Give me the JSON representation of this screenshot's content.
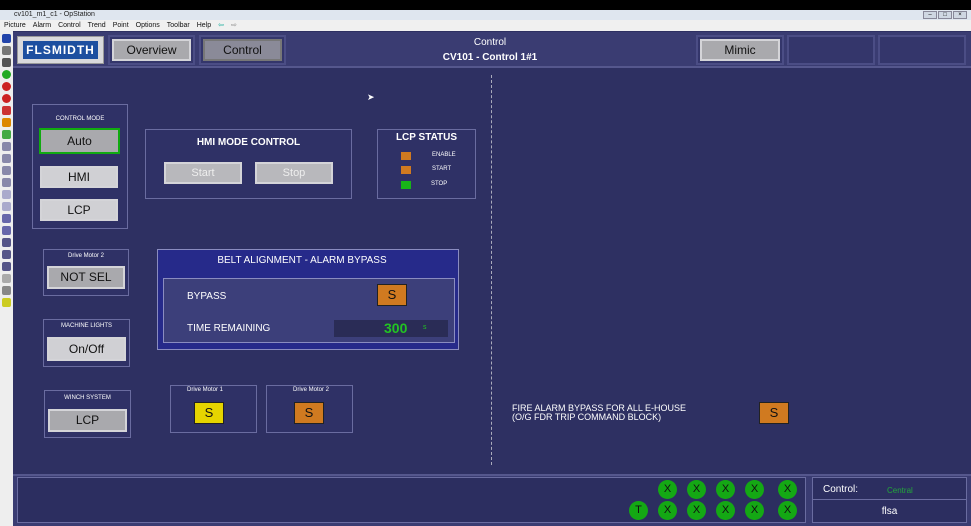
{
  "window": {
    "title": "cv101_m1_c1 - OpStation",
    "controls": [
      "–",
      "□",
      "×"
    ]
  },
  "menu": [
    "Picture",
    "Alarm",
    "Control",
    "Trend",
    "Point",
    "Options",
    "Toolbar",
    "Help"
  ],
  "header": {
    "logo": "FLSMIDTH",
    "overview": "Overview",
    "control": "Control",
    "title": "Control",
    "subtitle": "CV101 - Control 1#1",
    "mimic": "Mimic"
  },
  "control_mode": {
    "label": "CONTROL MODE",
    "auto": "Auto",
    "hmi": "HMI",
    "lcp": "LCP"
  },
  "hmi_mode": {
    "title": "HMI MODE CONTROL",
    "start": "Start",
    "stop": "Stop"
  },
  "lcp_status": {
    "title": "LCP STATUS",
    "items": [
      {
        "label": "ENABLE",
        "color": "#d07a20"
      },
      {
        "label": "START",
        "color": "#d07a20"
      },
      {
        "label": "STOP",
        "color": "#18b418"
      }
    ]
  },
  "drive_motor_2_sel": {
    "label": "Drive Motor 2",
    "value": "NOT SEL"
  },
  "machine_lights": {
    "label": "MACHINE LIGHTS",
    "value": "On/Off"
  },
  "winch": {
    "label": "WINCH SYSTEM",
    "value": "LCP"
  },
  "belt": {
    "title": "BELT ALIGNMENT - ALARM BYPASS",
    "bypass_label": "BYPASS",
    "bypass_state": "S",
    "time_label": "TIME REMAINING",
    "time_value": "300",
    "time_unit": "s"
  },
  "motors": [
    {
      "label": "Drive Motor 1",
      "state": "S",
      "color": "#e6d400"
    },
    {
      "label": "Drive Motor 2",
      "state": "S",
      "color": "#d07a20"
    }
  ],
  "fire": {
    "line1": "FIRE ALARM BYPASS FOR ALL E-HOUSE",
    "line2": "(O/G FDR TRIP COMMAND BLOCK)",
    "state": "S"
  },
  "footer": {
    "row1": [
      "X",
      "X",
      "X",
      "X",
      "X"
    ],
    "row2": [
      "T",
      "X",
      "X",
      "X",
      "X",
      "X"
    ],
    "control_label": "Control:",
    "control_value": "Central",
    "user": "flsa"
  }
}
